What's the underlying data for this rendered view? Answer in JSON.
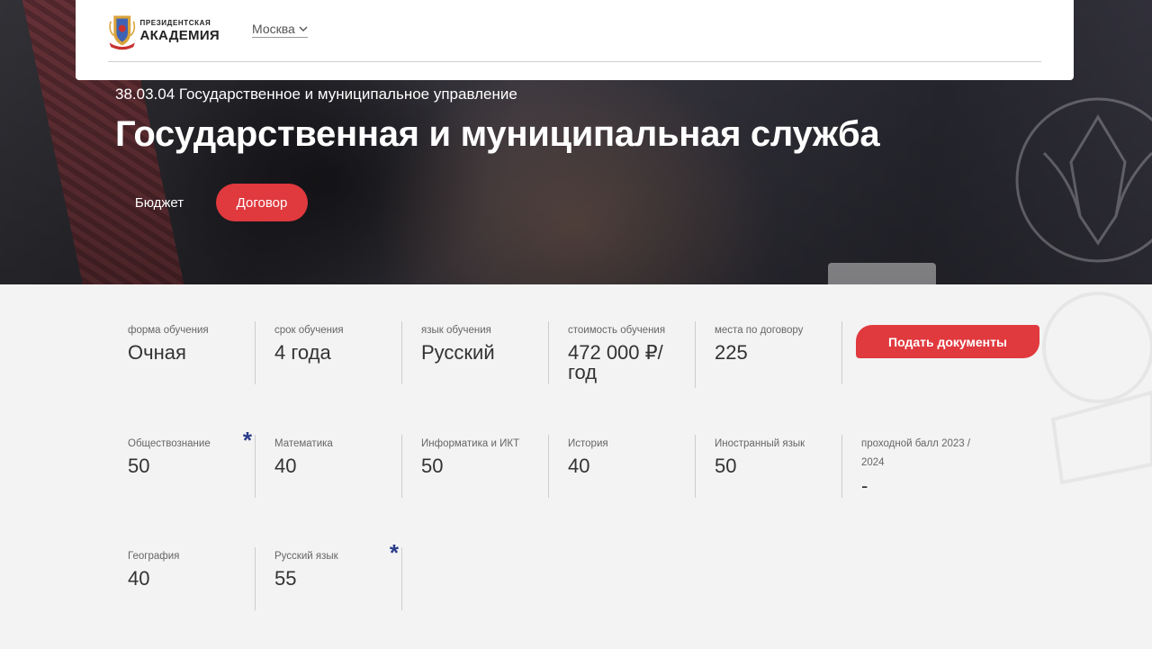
{
  "header": {
    "logo": {
      "line1": "ПРЕЗИДЕНТСКАЯ",
      "line2": "АКАДЕМИЯ"
    },
    "city": "Москва"
  },
  "hero": {
    "code": "38.03.04 Государственное и муниципальное управление",
    "title": "Государственная и муниципальная служба",
    "tabs": [
      {
        "label": "Бюджет",
        "active": false
      },
      {
        "label": "Договор",
        "active": true
      }
    ]
  },
  "info": [
    {
      "label": "форма обучения",
      "value": "Очная"
    },
    {
      "label": "срок обучения",
      "value": "4 года"
    },
    {
      "label": "язык обучения",
      "value": "Русский"
    },
    {
      "label": "стоимость обучения",
      "value": "472 000 ₽/ год"
    },
    {
      "label": "места по договору",
      "value": "225"
    }
  ],
  "submit_label": "Подать документы",
  "exams": [
    {
      "label": "Обществознание",
      "value": "50",
      "star": "*"
    },
    {
      "label": "Математика",
      "value": "40"
    },
    {
      "label": "Информатика и ИКТ",
      "value": "50"
    },
    {
      "label": "История",
      "value": "40"
    },
    {
      "label": "Иностранный язык",
      "value": "50"
    },
    {
      "label": "проходной балл 2023 / 2024",
      "value": "-"
    },
    {
      "label": "География",
      "value": "40"
    },
    {
      "label": "Русский язык",
      "value": "55",
      "star": "*"
    }
  ],
  "colors": {
    "accent": "#e0393e",
    "star": "#2a3c8a",
    "background": "#f3f3f3"
  }
}
